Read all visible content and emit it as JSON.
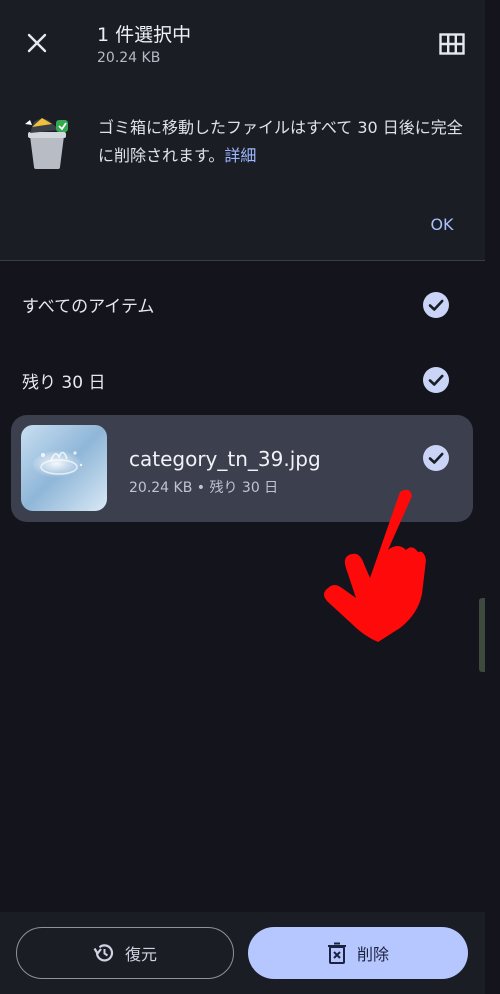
{
  "header": {
    "title": "1 件選択中",
    "subtitle": "20.24 KB",
    "close_icon": "close-icon",
    "grid_icon": "grid-view-icon"
  },
  "banner": {
    "message": "ゴミ箱に移動したファイルはすべて 30 日後に完全に削除されます。",
    "link": "詳細",
    "ok": "OK",
    "icon": "trash-can-icon"
  },
  "list": {
    "all_items": "すべてのアイテム",
    "remaining_group": "残り 30 日"
  },
  "file": {
    "name": "category_tn_39.jpg",
    "meta": "20.24 KB • 残り 30 日"
  },
  "actions": {
    "restore": "復元",
    "delete": "削除"
  },
  "colors": {
    "background": "#14151c",
    "surface": "#1b1d25",
    "card": "#3c404e",
    "accent": "#b6c7ff",
    "hand": "#ff0000"
  }
}
